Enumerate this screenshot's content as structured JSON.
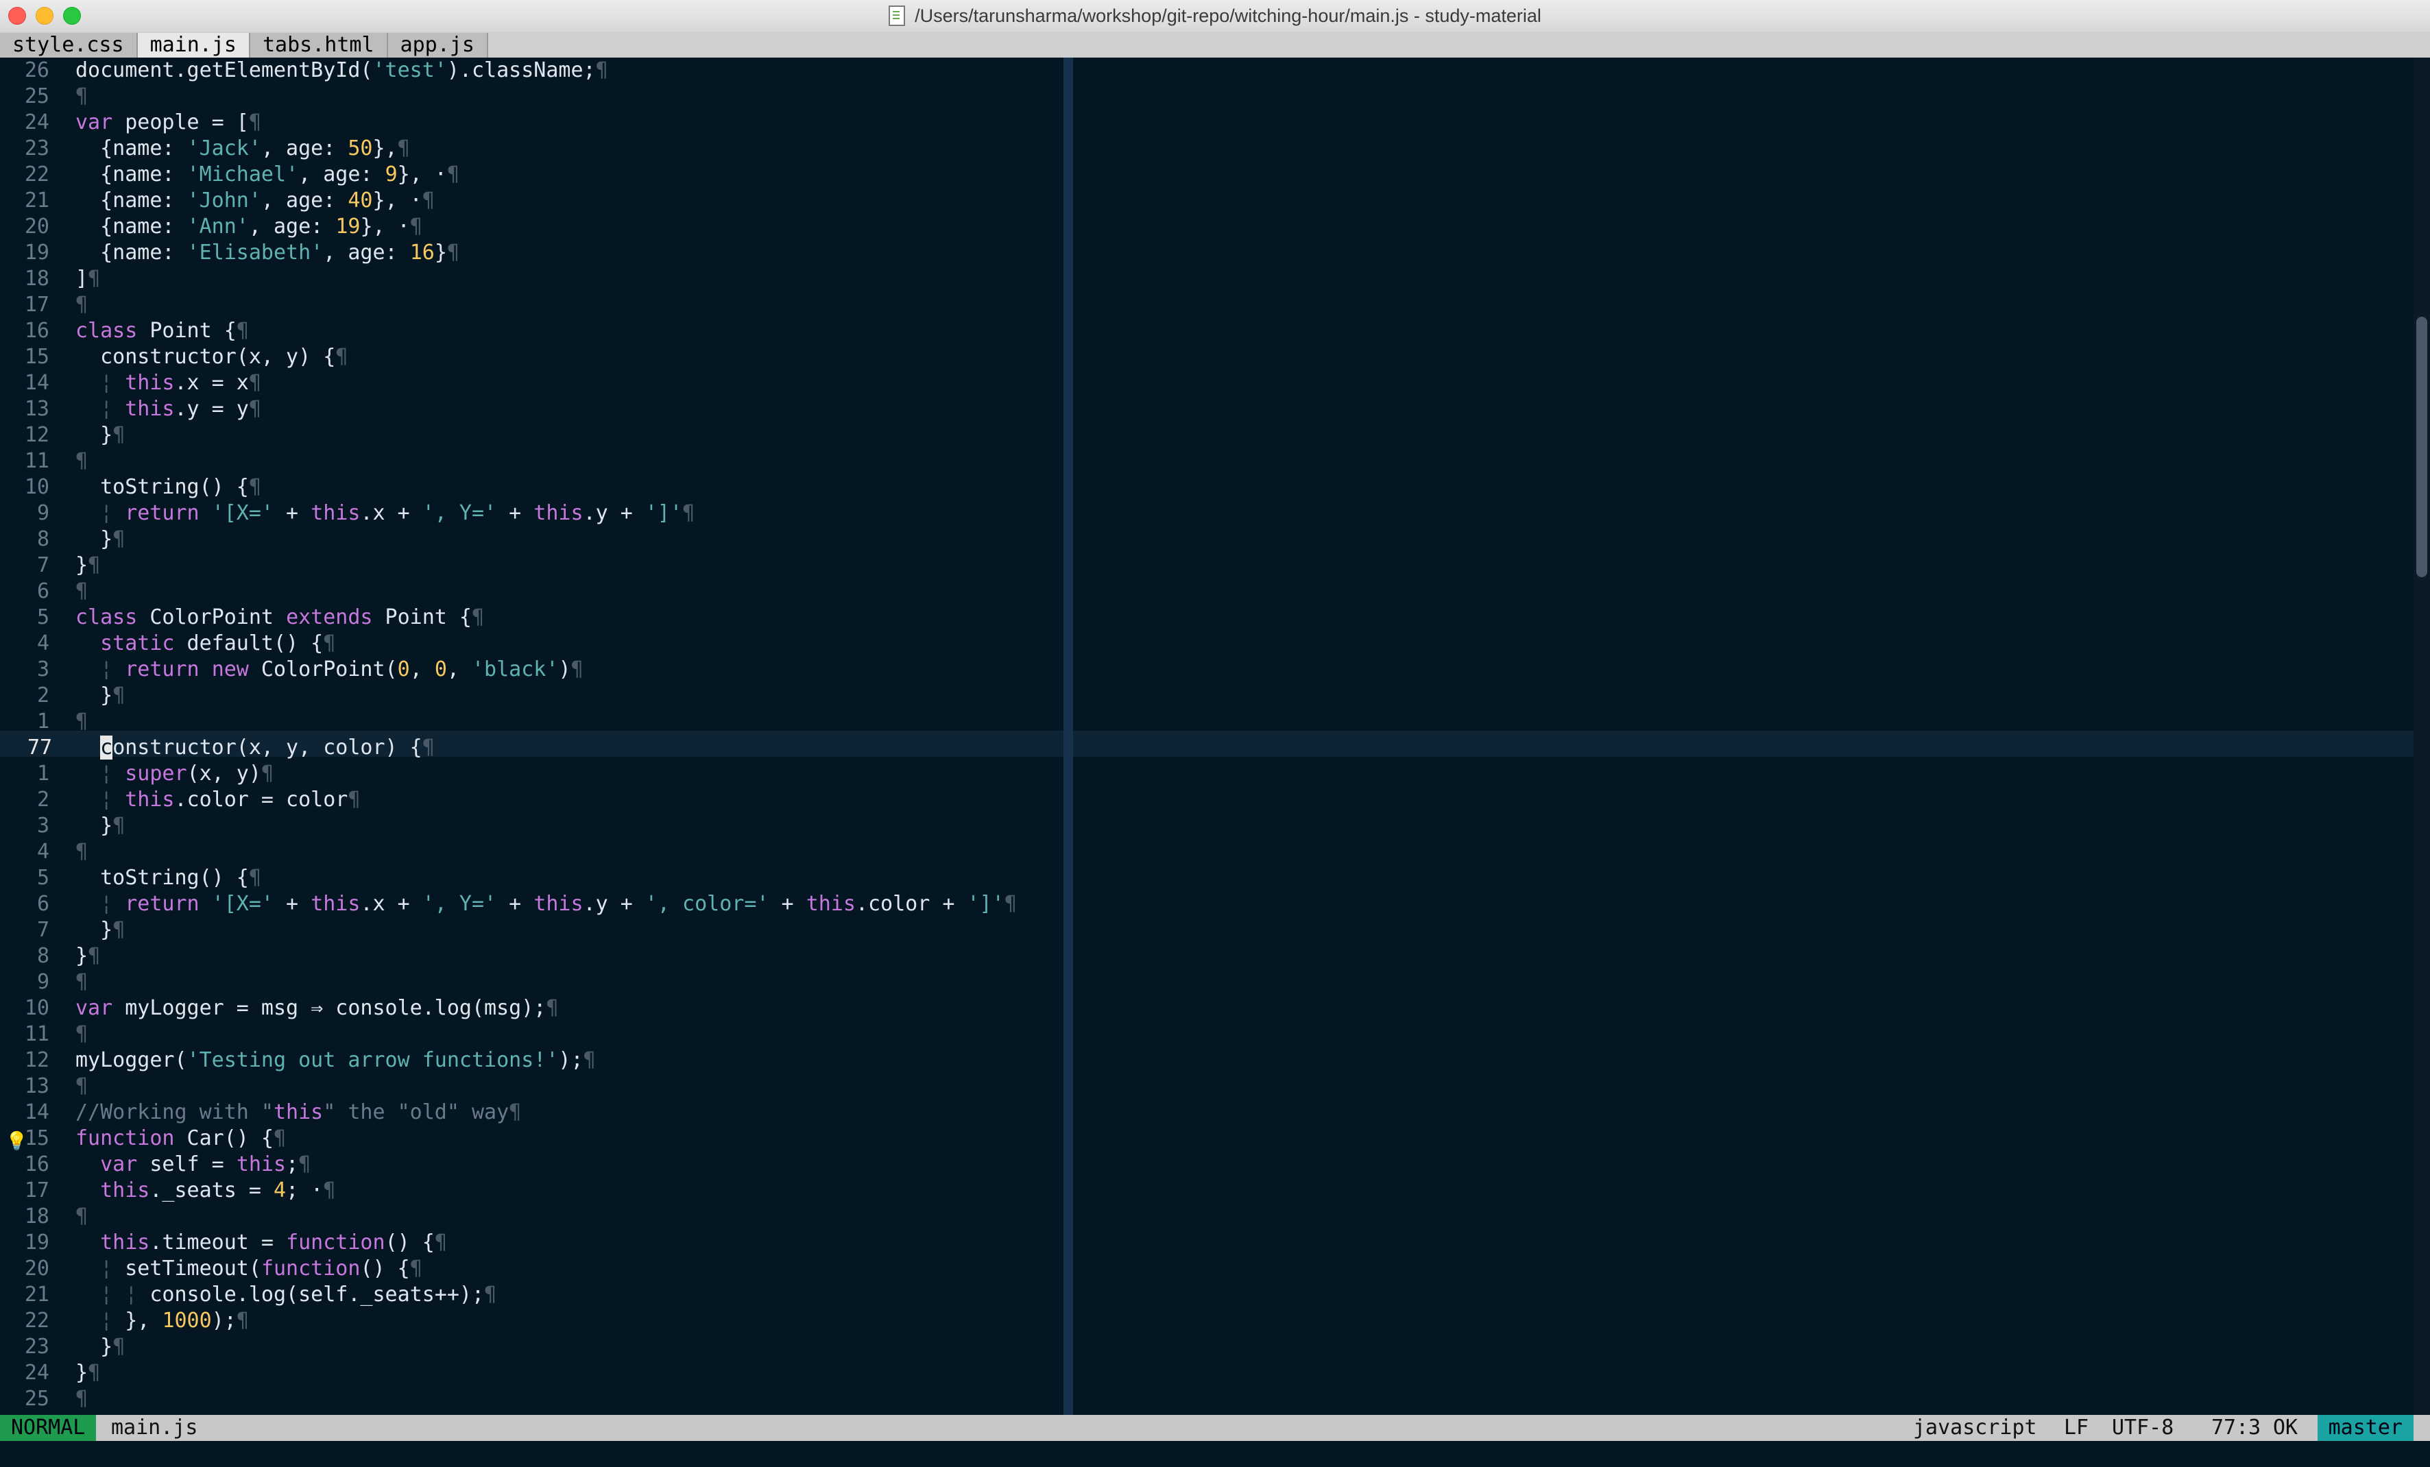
{
  "window": {
    "title": "/Users/tarunsharma/workshop/git-repo/witching-hour/main.js - study-material"
  },
  "tabs": [
    {
      "label": "style.css",
      "active": false
    },
    {
      "label": "main.js",
      "active": true
    },
    {
      "label": "tabs.html",
      "active": false
    },
    {
      "label": "app.js",
      "active": false
    }
  ],
  "editor": {
    "lines": [
      {
        "num": "26",
        "code": "document.getElementById('test').className;¶"
      },
      {
        "num": "25",
        "code": "¶"
      },
      {
        "num": "24",
        "code": "var people = [¶"
      },
      {
        "num": "23",
        "code": "  {name: 'Jack', age: 50},¶"
      },
      {
        "num": "22",
        "code": "  {name: 'Michael', age: 9}, ·¶"
      },
      {
        "num": "21",
        "code": "  {name: 'John', age: 40}, ·¶"
      },
      {
        "num": "20",
        "code": "  {name: 'Ann', age: 19}, ·¶"
      },
      {
        "num": "19",
        "code": "  {name: 'Elisabeth', age: 16}¶"
      },
      {
        "num": "18",
        "code": "]¶"
      },
      {
        "num": "17",
        "code": "¶"
      },
      {
        "num": "16",
        "code": "class Point {¶"
      },
      {
        "num": "15",
        "code": "  constructor(x, y) {¶"
      },
      {
        "num": "14",
        "code": "  ¦ this.x = x¶"
      },
      {
        "num": "13",
        "code": "  ¦ this.y = y¶"
      },
      {
        "num": "12",
        "code": "  }¶"
      },
      {
        "num": "11",
        "code": "¶"
      },
      {
        "num": "10",
        "code": "  toString() {¶"
      },
      {
        "num": "9",
        "code": "  ¦ return '[X=' + this.x + ', Y=' + this.y + ']'¶"
      },
      {
        "num": "8",
        "code": "  }¶"
      },
      {
        "num": "7",
        "code": "}¶"
      },
      {
        "num": "6",
        "code": "¶"
      },
      {
        "num": "5",
        "code": "class ColorPoint extends Point {¶"
      },
      {
        "num": "4",
        "code": "  static default() {¶"
      },
      {
        "num": "3",
        "code": "  ¦ return new ColorPoint(0, 0, 'black')¶"
      },
      {
        "num": "2",
        "code": "  }¶"
      },
      {
        "num": "1",
        "code": "¶"
      },
      {
        "num": "77",
        "code": "  constructor(x, y, color) {¶",
        "current": true
      },
      {
        "num": "1",
        "code": "  ¦ super(x, y)¶"
      },
      {
        "num": "2",
        "code": "  ¦ this.color = color¶"
      },
      {
        "num": "3",
        "code": "  }¶"
      },
      {
        "num": "4",
        "code": "¶"
      },
      {
        "num": "5",
        "code": "  toString() {¶"
      },
      {
        "num": "6",
        "code": "  ¦ return '[X=' + this.x + ', Y=' + this.y + ', color=' + this.color + ']'¶"
      },
      {
        "num": "7",
        "code": "  }¶"
      },
      {
        "num": "8",
        "code": "}¶"
      },
      {
        "num": "9",
        "code": "¶"
      },
      {
        "num": "10",
        "code": "var myLogger = msg ⇒ console.log(msg);¶"
      },
      {
        "num": "11",
        "code": "¶"
      },
      {
        "num": "12",
        "code": "myLogger('Testing out arrow functions!');¶"
      },
      {
        "num": "13",
        "code": "¶"
      },
      {
        "num": "14",
        "code": "//Working with \"this\" the \"old\" way¶"
      },
      {
        "num": "15",
        "code": "function Car() {¶",
        "bulb": true
      },
      {
        "num": "16",
        "code": "  var self = this;¶"
      },
      {
        "num": "17",
        "code": "  this._seats = 4; ·¶"
      },
      {
        "num": "18",
        "code": "¶"
      },
      {
        "num": "19",
        "code": "  this.timeout = function() {¶"
      },
      {
        "num": "20",
        "code": "  ¦ setTimeout(function() {¶"
      },
      {
        "num": "21",
        "code": "  ¦ ¦ console.log(self._seats++);¶"
      },
      {
        "num": "22",
        "code": "  ¦ }, 1000);¶"
      },
      {
        "num": "23",
        "code": "  }¶"
      },
      {
        "num": "24",
        "code": "}¶"
      },
      {
        "num": "25",
        "code": "¶"
      }
    ],
    "bulb_icon": "lightbulb-icon"
  },
  "statusline": {
    "mode": "NORMAL",
    "filename": "main.js",
    "filetype": "javascript",
    "line_ending": "LF",
    "encoding": "UTF-8",
    "position": "77:3",
    "lint": "OK",
    "branch": "master"
  },
  "colors": {
    "background": "#051623",
    "mode_bg": "#1f9b4e",
    "branch_bg": "#1aa3a3"
  }
}
